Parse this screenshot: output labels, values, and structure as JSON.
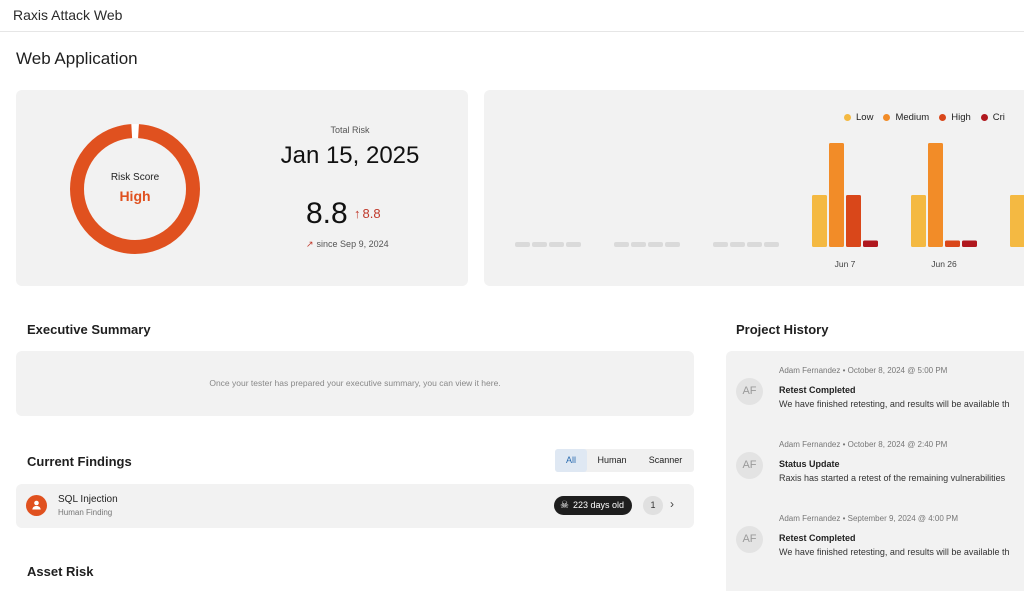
{
  "app": {
    "title": "Raxis Attack Web"
  },
  "page": {
    "title": "Web Application"
  },
  "risk": {
    "donut_label": "Risk Score",
    "donut_value": "High",
    "donut_fill_fraction": 0.98,
    "total_risk_label": "Total Risk",
    "date": "Jan 15, 2025",
    "score": "8.8",
    "delta": "8.8",
    "since": "since Sep 9, 2024",
    "colors": {
      "donut": "#e0511f",
      "up": "#c0392b"
    }
  },
  "chart_data": {
    "type": "bar",
    "categories": [
      "",
      "",
      "",
      "Jun 7",
      "Jun 26",
      ""
    ],
    "series": [
      {
        "name": "Low",
        "color": "#f4b942",
        "values": [
          0,
          0,
          0,
          2,
          2,
          2
        ]
      },
      {
        "name": "Medium",
        "color": "#f28c28",
        "values": [
          0,
          0,
          0,
          4,
          4,
          0
        ]
      },
      {
        "name": "High",
        "color": "#d9471a",
        "values": [
          0,
          0,
          0,
          2,
          0.25,
          0
        ]
      },
      {
        "name": "Critical",
        "color": "#b0181e",
        "values": [
          0,
          0,
          0,
          0.25,
          0.25,
          0
        ]
      }
    ],
    "legend": {
      "labels": [
        "Low",
        "Medium",
        "High",
        "Cri"
      ],
      "position": "top-right"
    },
    "ylim": [
      0,
      4
    ],
    "grid": false
  },
  "exec_summary": {
    "title": "Executive Summary",
    "placeholder": "Once your tester has prepared your executive summary, you can view it here."
  },
  "findings": {
    "title": "Current Findings",
    "filters": [
      "All",
      "Human",
      "Scanner"
    ],
    "active_filter": "All",
    "items": [
      {
        "name": "SQL Injection",
        "type": "Human Finding",
        "age": "223 days old",
        "count": "1"
      }
    ]
  },
  "history": {
    "title": "Project History",
    "items": [
      {
        "initials": "AF",
        "meta": "Adam Fernandez • October 8, 2024 @ 5:00 PM",
        "title": "Retest Completed",
        "desc": "We have finished retesting, and results will be available th"
      },
      {
        "initials": "AF",
        "meta": "Adam Fernandez • October 8, 2024 @ 2:40 PM",
        "title": "Status Update",
        "desc": "Raxis has started a retest of the remaining vulnerabilities"
      },
      {
        "initials": "AF",
        "meta": "Adam Fernandez • September 9, 2024 @ 4:00 PM",
        "title": "Retest Completed",
        "desc": "We have finished retesting, and results will be available th"
      }
    ]
  },
  "asset_risk": {
    "title": "Asset Risk"
  }
}
